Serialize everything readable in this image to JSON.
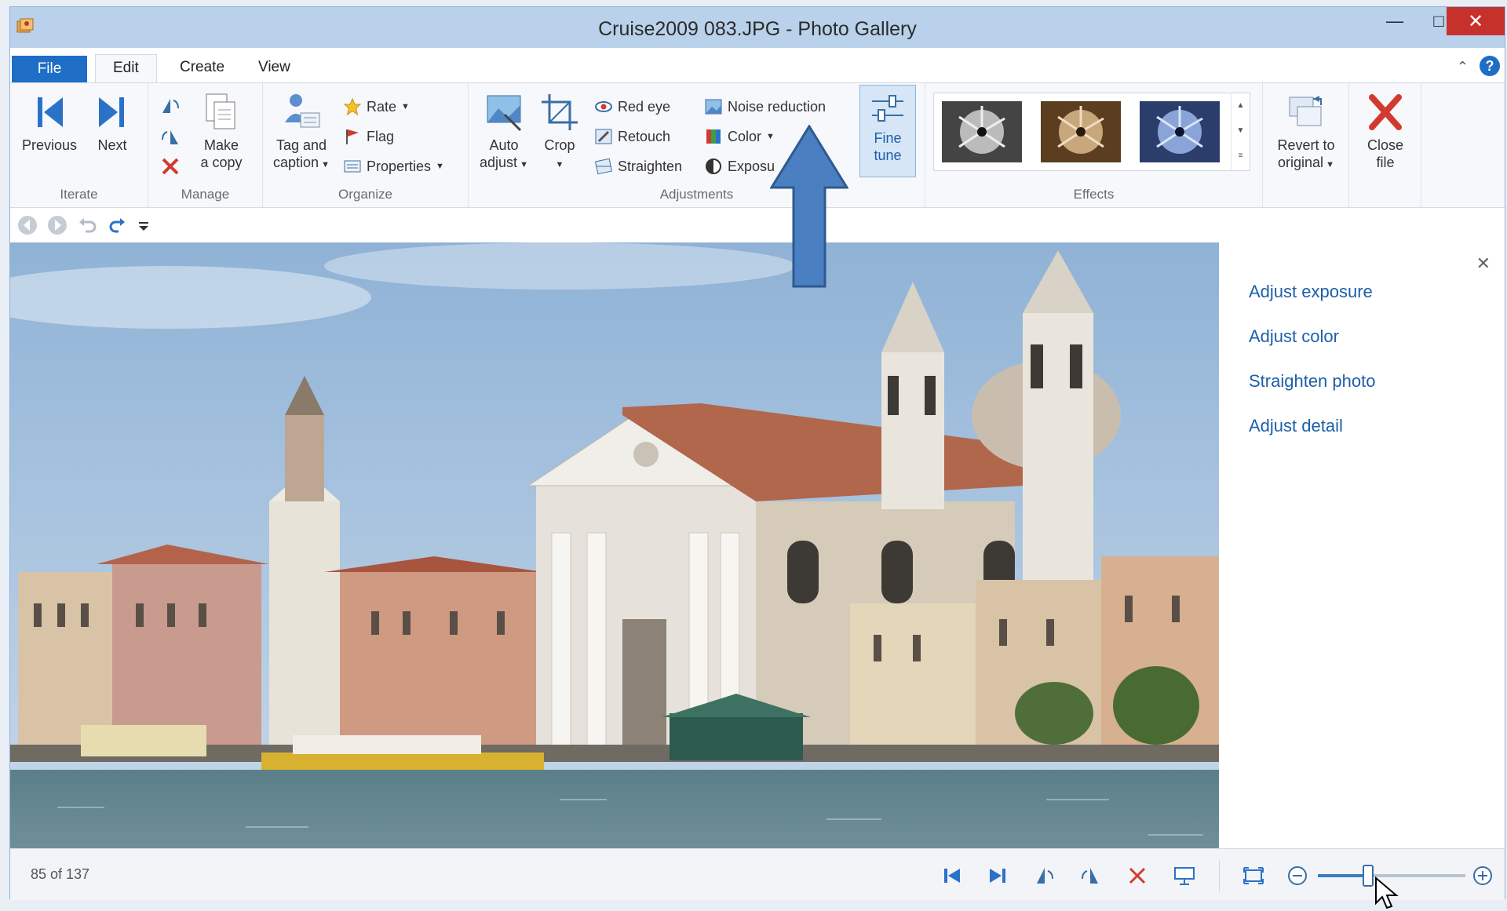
{
  "window": {
    "title": "Cruise2009 083.JPG - Photo Gallery"
  },
  "tabs": [
    {
      "label": "File"
    },
    {
      "label": "Edit"
    },
    {
      "label": "Create"
    },
    {
      "label": "View"
    }
  ],
  "ribbon": {
    "iterate": {
      "label": "Iterate",
      "previous": "Previous",
      "next": "Next"
    },
    "manage": {
      "label": "Manage",
      "make_copy_line1": "Make",
      "make_copy_line2": "a copy"
    },
    "organize": {
      "label": "Organize",
      "tag_line1": "Tag and",
      "tag_line2": "caption",
      "rate": "Rate",
      "flag": "Flag",
      "properties": "Properties"
    },
    "adjustments": {
      "label": "Adjustments",
      "auto_line1": "Auto",
      "auto_line2": "adjust",
      "crop": "Crop",
      "red_eye": "Red eye",
      "retouch": "Retouch",
      "straighten": "Straighten",
      "noise_reduction": "Noise reduction",
      "color": "Color",
      "exposure": "Exposu",
      "fine_line1": "Fine",
      "fine_line2": "tune"
    },
    "effects": {
      "label": "Effects"
    },
    "revert": {
      "line1": "Revert to",
      "line2": "original"
    },
    "close": {
      "line1": "Close",
      "line2": "file"
    }
  },
  "side_pane": {
    "links": [
      "Adjust exposure",
      "Adjust color",
      "Straighten photo",
      "Adjust detail"
    ]
  },
  "status": {
    "counter": "85 of 137",
    "zoom_level": 0.34
  },
  "colors": {
    "accent": "#1e6ec5",
    "close": "#c7312b",
    "annotation_arrow": "#4a7fc1"
  }
}
